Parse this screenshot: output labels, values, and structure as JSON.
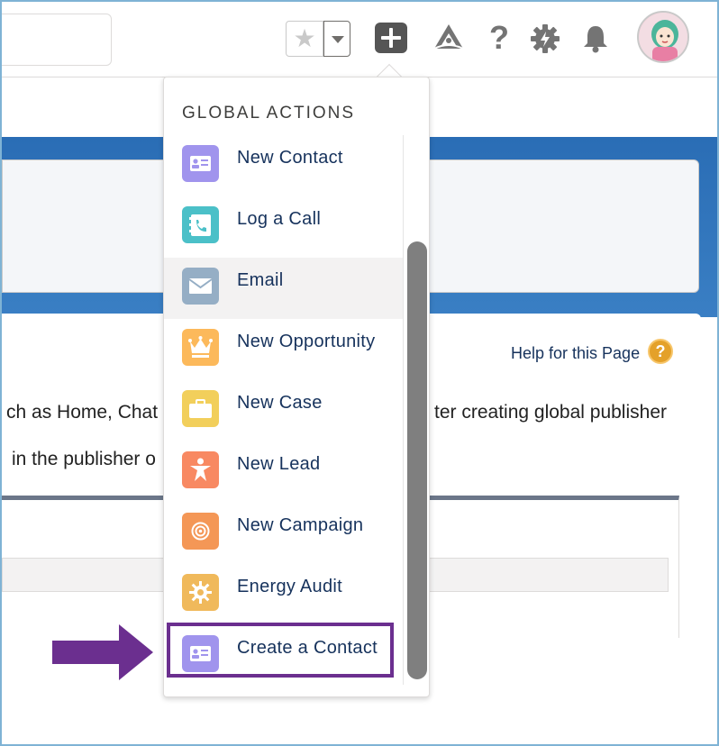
{
  "header": {
    "icons": [
      "star-icon",
      "chevron-down-icon",
      "plus-icon",
      "trailhead-icon",
      "help-icon",
      "setup-gear-icon",
      "bell-icon",
      "avatar"
    ]
  },
  "dropdown": {
    "title": "GLOBAL ACTIONS",
    "items": [
      {
        "label": "New Contact",
        "icon": "contact-card-icon",
        "color": "#a094ed"
      },
      {
        "label": "Log a Call",
        "icon": "log-call-icon",
        "color": "#4bc0c8"
      },
      {
        "label": "Email",
        "icon": "email-icon",
        "color": "#95aec5"
      },
      {
        "label": "New Opportunity",
        "icon": "crown-icon",
        "color": "#fcb95b"
      },
      {
        "label": "New Case",
        "icon": "briefcase-icon",
        "color": "#f2cf5b"
      },
      {
        "label": "New Lead",
        "icon": "lead-person-icon",
        "color": "#f88962"
      },
      {
        "label": "New Campaign",
        "icon": "target-icon",
        "color": "#f49756"
      },
      {
        "label": "Energy Audit",
        "icon": "gear-icon",
        "color": "#f0b95b"
      },
      {
        "label": "Create a Contact",
        "icon": "contact-card-icon",
        "color": "#a094ed"
      }
    ]
  },
  "page": {
    "help_link": "Help for this Page",
    "text_line1_left": "ch as Home, Chat",
    "text_line1_right": "ter creating global publisher",
    "text_line2": "in the publisher o"
  },
  "colors": {
    "highlight": "#6b2f8f",
    "arrow": "#6b2f8f",
    "banner": "#2a6db5"
  }
}
